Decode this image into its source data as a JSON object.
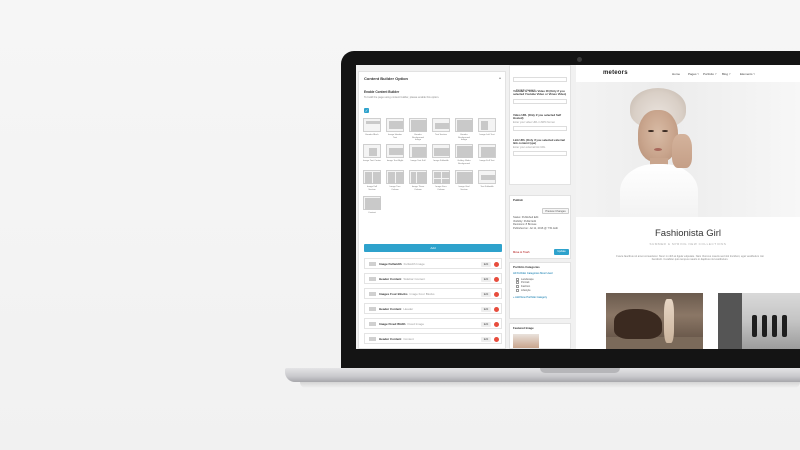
{
  "admin": {
    "builder_title": "Content Builder Option",
    "enable_label": "Enable Content Builder",
    "enable_hint": "To build the page using content builder, please enable this option.",
    "add_label": "Add",
    "layouts": [
      {
        "label": "Header Block"
      },
      {
        "label": "Image Header Text"
      },
      {
        "label": "Header Background Image"
      },
      {
        "label": "Text Section"
      },
      {
        "label": "Header Background Image"
      },
      {
        "label": "Image Left Text"
      },
      {
        "label": "Image Text Center"
      },
      {
        "label": "Image Text Right"
      },
      {
        "label": "Image Text Full"
      },
      {
        "label": "Image Fullwidth"
      },
      {
        "label": "Gallery Slider Background"
      },
      {
        "label": "Image Full Text"
      },
      {
        "label": "Image Full Section"
      },
      {
        "label": "Image Two Column"
      },
      {
        "label": "Image Three Column"
      },
      {
        "label": "Image Four Column"
      },
      {
        "label": "Image Grid Section"
      },
      {
        "label": "Text Fullwidth"
      },
      {
        "label": "Content"
      }
    ],
    "rows": [
      {
        "name": "Image Fullwidth",
        "sub": "Fullwidth Image",
        "edit": "Edit"
      },
      {
        "name": "Header Content",
        "sub": "Sidebar Content",
        "edit": "Edit"
      },
      {
        "name": "Images Four Blocks",
        "sub": "Image Four Blocks",
        "edit": "Edit"
      },
      {
        "name": "Header Content",
        "sub": "Header",
        "edit": "Edit"
      },
      {
        "name": "Image Fixed Width",
        "sub": "Fixed Image",
        "edit": "Edit"
      },
      {
        "name": "Header Content",
        "sub": "Content",
        "edit": "Edit"
      }
    ]
  },
  "side": {
    "type_label": "Portfolio Content",
    "youtube_label": "Youtube or Vimeo Video ID (Only if you selected Youtube Video or Vimeo Video)",
    "video_url_label": "Video URL (Only if you selected Self Hosted)",
    "video_url_hint": "Enter your video URL in MP4 format",
    "link_url_label": "Link URL (Only if you selected external link content type)",
    "link_url_hint": "Enter your external link URL",
    "publish_title": "Publish",
    "preview_label": "Preview Changes",
    "status": "Status: Published Edit",
    "visibility": "Visibility: Public Edit",
    "revisions": "Revisions: 8 Browse",
    "published_on": "Published on: Jul 11, 2016 @ 7:51 Edit",
    "trash_label": "Move to Trash",
    "update_label": "Update",
    "categories_title": "Portfolio Categories",
    "categories_tabs": "All Portfolio Categories   Most Used",
    "categories": [
      "Landscape",
      "Portrait",
      "Fashion",
      "Lifestyle"
    ],
    "add_category": "+ Add New Portfolio Category",
    "featured_title": "Featured Image"
  },
  "site": {
    "logo": "meteors",
    "nav": [
      "Home",
      "Pages",
      "Portfolio",
      "Blog",
      "Elements"
    ],
    "post_title": "Fashionista Girl",
    "post_sub": "SUMMER & SPRING NEW COLLECTIONS",
    "post_text": "Fusce faucibus sit amet consectetur. Nunc in nibh at ligula vulputate. Nam rhoncus mauris sed nisl tincidunt, eget vestibulum nisi hendrerit. Curabitur quis tempus mauris in dapibus nisl vestibulum."
  },
  "colors": {
    "accent": "#2ea2cc",
    "delete": "#e74c3c",
    "bezel": "#141414"
  }
}
